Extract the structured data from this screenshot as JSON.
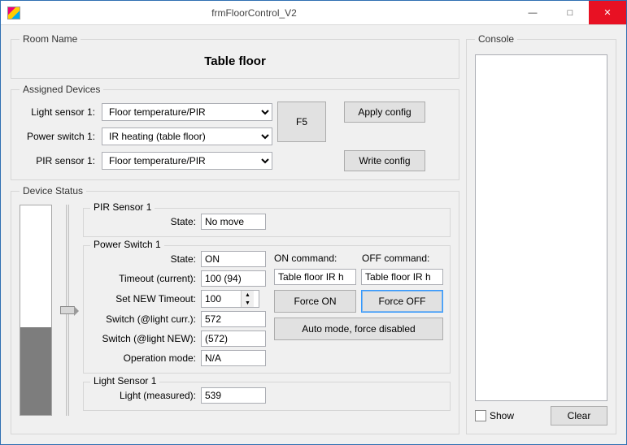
{
  "window": {
    "title": "frmFloorControl_V2"
  },
  "room": {
    "legend": "Room Name",
    "value": "Table floor"
  },
  "assigned": {
    "legend": "Assigned Devices",
    "light_sensor_label": "Light sensor 1:",
    "light_sensor_value": "Floor temperature/PIR",
    "power_switch_label": "Power switch 1:",
    "power_switch_value": "IR heating (table floor)",
    "pir_sensor_label": "PIR sensor 1:",
    "pir_sensor_value": "Floor temperature/PIR",
    "f5_label": "F5",
    "apply_label": "Apply config",
    "write_label": "Write config"
  },
  "device_status": {
    "legend": "Device Status",
    "gauge_fill_percent": 42,
    "pir": {
      "title": "PIR Sensor 1",
      "state_label": "State:",
      "state_value": "No move"
    },
    "ps": {
      "title": "Power Switch 1",
      "state_label": "State:",
      "state_value": "ON",
      "timeout_curr_label": "Timeout (current):",
      "timeout_curr_value": "100 (94)",
      "set_new_timeout_label": "Set NEW Timeout:",
      "set_new_timeout_value": "100",
      "switch_light_curr_label": "Switch (@light curr.):",
      "switch_light_curr_value": "572",
      "switch_light_new_label": "Switch (@light NEW):",
      "switch_light_new_value": "(572)",
      "op_mode_label": "Operation mode:",
      "op_mode_value": "N/A",
      "on_cmd_label": "ON command:",
      "off_cmd_label": "OFF command:",
      "on_cmd_value": "Table floor IR h",
      "off_cmd_value": "Table floor IR h",
      "force_on_label": "Force ON",
      "force_off_label": "Force OFF",
      "auto_mode_label": "Auto mode, force disabled"
    },
    "light": {
      "title": "Light Sensor 1",
      "measured_label": "Light (measured):",
      "measured_value": "539"
    }
  },
  "console": {
    "legend": "Console",
    "show_label": "Show",
    "clear_label": "Clear"
  }
}
